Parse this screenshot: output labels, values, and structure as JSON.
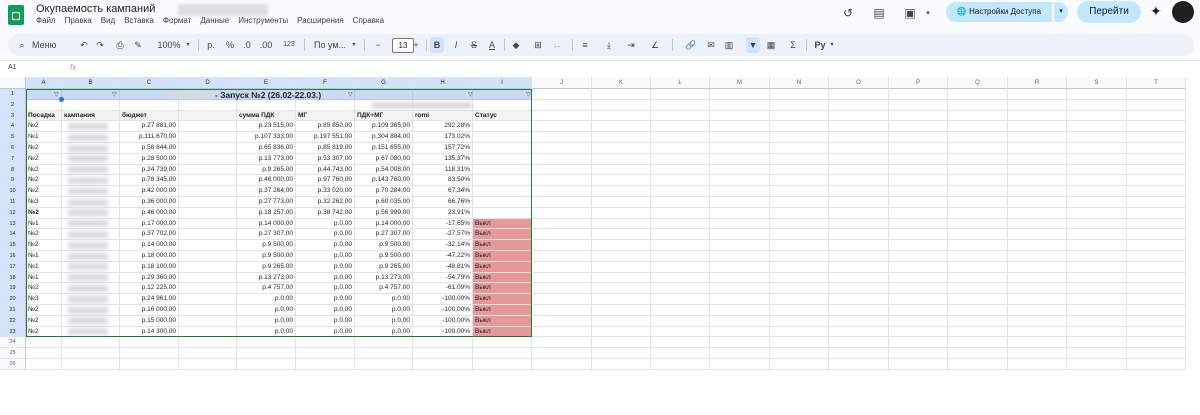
{
  "header": {
    "doc_title": "Окупаемость кампаний",
    "menu": [
      "Файл",
      "Правка",
      "Вид",
      "Вставка",
      "Формат",
      "Данные",
      "Инструменты",
      "Расширения",
      "Справка"
    ],
    "share_label": "Настройки Доступа",
    "goto_label": "Перейти",
    "icons": [
      "history-icon",
      "comment-icon",
      "meet-icon",
      "globe-icon",
      "gemini-star-icon",
      "avatar"
    ]
  },
  "toolbar": {
    "menu_search": "Меню",
    "zoom": "100%",
    "currency": "р.",
    "percent": "%",
    "dec_dec": ".0",
    "dec_inc": ".00",
    "num_format": "123",
    "font": "По ум...",
    "font_size": "13",
    "minus": "−",
    "plus": "+",
    "bold": "B",
    "italic": "I",
    "strike": "S",
    "text_color": "A",
    "sigma": "Σ",
    "ru": "Ру"
  },
  "formula_bar": {
    "name_box": "A1",
    "fx": "fx"
  },
  "columns": [
    "A",
    "B",
    "C",
    "D",
    "E",
    "F",
    "G",
    "H",
    "I",
    "J",
    "K",
    "L",
    "M",
    "N",
    "O",
    "P",
    "Q",
    "R",
    "S",
    "T"
  ],
  "rows": [
    "1",
    "2",
    "3",
    "4",
    "5",
    "6",
    "7",
    "8",
    "9",
    "10",
    "11",
    "12",
    "13",
    "14",
    "15",
    "16",
    "17",
    "18",
    "19",
    "20",
    "21",
    "22",
    "23",
    "24",
    "25",
    "26"
  ],
  "sheet": {
    "title": "- Запуск №2 (26.02-22.03.)",
    "headers": [
      "Посадка",
      "кампания",
      "бюджет",
      "",
      "сумма ПДК",
      "МГ",
      "ПДК+МГ",
      "romi",
      "Статус"
    ],
    "data": [
      [
        "№2",
        "",
        "р.27 881,00",
        "",
        "р.23 515,00",
        "р.85 850,00",
        "р.109 365,00",
        "292,28%",
        ""
      ],
      [
        "№1",
        "",
        "р.111 670,00",
        "",
        "р.107 333,00",
        "р.197 551,00",
        "р.304 884,00",
        "173,02%",
        ""
      ],
      [
        "№2",
        "",
        "р.58 844,00",
        "",
        "р.65 836,00",
        "р.85 819,00",
        "р.151 655,00",
        "157,72%",
        ""
      ],
      [
        "№2",
        "",
        "р.28 500,00",
        "",
        "р.13 773,00",
        "р.53 307,00",
        "р.67 080,00",
        "135,37%",
        ""
      ],
      [
        "№2",
        "",
        "р.24 739,00",
        "",
        "р.9 265,00",
        "р.44 743,00",
        "р.54 008,00",
        "118,31%",
        ""
      ],
      [
        "№2",
        "",
        "р.78 345,00",
        "",
        "р.46 000,00",
        "р.97 760,00",
        "р.143 760,00",
        "83,50%",
        ""
      ],
      [
        "№2",
        "",
        "р.42 000,00",
        "",
        "р.37 264,00",
        "р.33 020,00",
        "р.70 284,00",
        "67,34%",
        ""
      ],
      [
        "№3",
        "",
        "р.36 000,00",
        "",
        "р.27 773,00",
        "р.32 262,00",
        "р.60 035,00",
        "66,76%",
        ""
      ],
      [
        "№2",
        "",
        "р.46 000,00",
        "",
        "р.18 257,00",
        "р.38 742,00",
        "р.56 999,00",
        "23,91%",
        ""
      ],
      [
        "№1",
        "",
        "р.17 000,00",
        "",
        "р.14 000,00",
        "р.0,00",
        "р.14 000,00",
        "-17,65%",
        "Выкл"
      ],
      [
        "№2",
        "",
        "р.37 702,00",
        "",
        "р.27 307,00",
        "р.0,00",
        "р.27 307,00",
        "-27,57%",
        "Выкл"
      ],
      [
        "№2",
        "",
        "р.14 000,00",
        "",
        "р.9 500,00",
        "р.0,00",
        "р.9 500,00",
        "-32,14%",
        "Выкл"
      ],
      [
        "№1",
        "",
        "р.18 000,00",
        "",
        "р.9 500,00",
        "р.0,00",
        "р.9 500,00",
        "-47,22%",
        "Выкл"
      ],
      [
        "№1",
        "",
        "р.18 100,00",
        "",
        "р.9 265,00",
        "р.0,00",
        "р.9 265,00",
        "-48,81%",
        "Выкл"
      ],
      [
        "№1",
        "",
        "р.29 360,00",
        "",
        "р.13 273,00",
        "р.0,00",
        "р.13 273,00",
        "-54,79%",
        "Выкл"
      ],
      [
        "№2",
        "",
        "р.12 225,00",
        "",
        "р.4 757,00",
        "р.0,00",
        "р.4 757,00",
        "-61,09%",
        "Выкл"
      ],
      [
        "№3",
        "",
        "р.24 961,00",
        "",
        "р.0,00",
        "р.0,00",
        "р.0,00",
        "-100,00%",
        "Выкл"
      ],
      [
        "№2",
        "",
        "р.16 000,00",
        "",
        "р.0,00",
        "р.0,00",
        "р.0,00",
        "-100,00%",
        "Выкл"
      ],
      [
        "№2",
        "",
        "р.15 000,00",
        "",
        "р.0,00",
        "р.0,00",
        "р.0,00",
        "-100,00%",
        "Выкл"
      ],
      [
        "№2",
        "",
        "р.14 300,00",
        "",
        "р.0,00",
        "р.0,00",
        "р.0,00",
        "-100,00%",
        "Выкл"
      ]
    ],
    "off_color": "#e69999",
    "header_band_color": "#c9daf8"
  }
}
